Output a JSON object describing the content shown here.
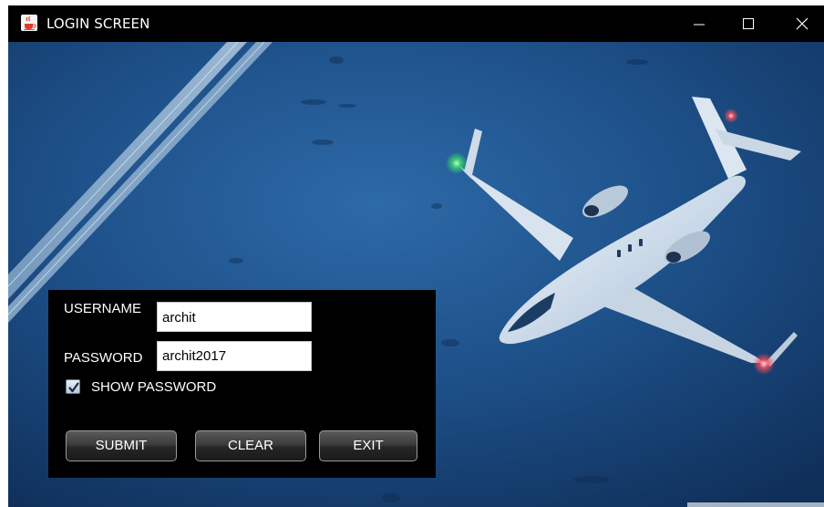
{
  "window": {
    "title": "LOGIN SCREEN",
    "icon": "java-coffee-cup-icon",
    "controls": {
      "minimize_icon": "minimize-icon",
      "maximize_icon": "maximize-icon",
      "close_icon": "close-icon"
    }
  },
  "login": {
    "username_label": "USERNAME",
    "username_value": "archit",
    "password_label": "PASSWORD",
    "password_value": "archit2017",
    "show_password_label": "SHOW PASSWORD",
    "show_password_checked": true,
    "submit_label": "SUBMIT",
    "clear_label": "CLEAR",
    "exit_label": "EXIT"
  },
  "colors": {
    "titlebar": "#000000",
    "panel": "#000000",
    "background_blue": "#1f4f86"
  }
}
